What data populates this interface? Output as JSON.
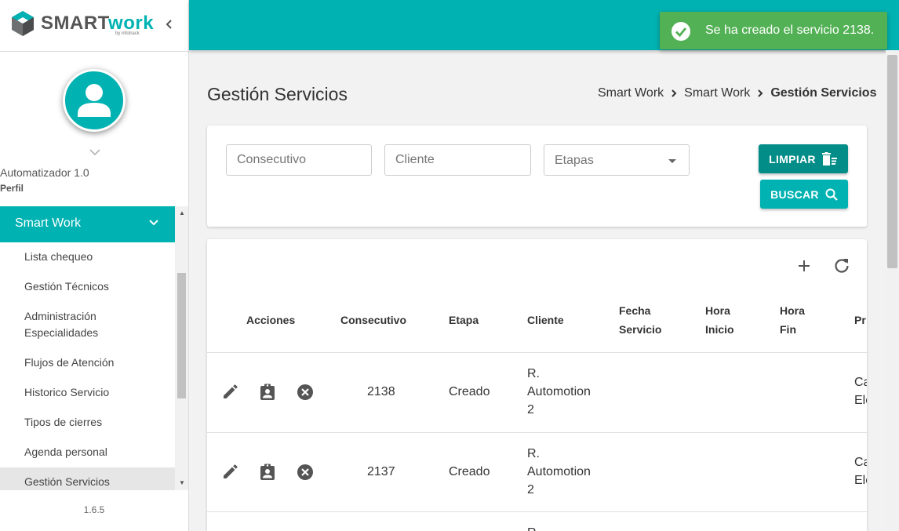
{
  "app": {
    "logo_a": "SMART",
    "logo_b": "WORK",
    "logo_sub": "by infotrack"
  },
  "profile": {
    "name": "Automatizador 1.0",
    "role": "Perfil"
  },
  "sidebar": {
    "section": "Smart Work",
    "items": [
      {
        "label": "Lista chequeo"
      },
      {
        "label": "Gestión Técnicos"
      },
      {
        "label": "Administración Especialidades"
      },
      {
        "label": "Flujos de Atención"
      },
      {
        "label": "Historico Servicio"
      },
      {
        "label": "Tipos de cierres"
      },
      {
        "label": "Agenda personal"
      },
      {
        "label": "Gestión Servicios"
      }
    ],
    "version": "1.6.5"
  },
  "toast": {
    "text": "Se ha creado el servicio 2138."
  },
  "page": {
    "title": "Gestión Servicios",
    "breadcrumb": [
      "Smart Work",
      "Smart Work",
      "Gestión Servicios"
    ]
  },
  "filters": {
    "consecutivo_placeholder": "Consecutivo",
    "cliente_placeholder": "Cliente",
    "etapas_label": "Etapas",
    "clear_label": "LIMPIAR",
    "search_label": "BUSCAR"
  },
  "table": {
    "headers": {
      "acciones": "Acciones",
      "consecutivo": "Consecutivo",
      "etapa": "Etapa",
      "cliente": "Cliente",
      "fecha_1": "Fecha",
      "fecha_2": "Servicio",
      "hora_inicio_1": "Hora",
      "hora_inicio_2": "Inicio",
      "hora_fin_1": "Hora",
      "hora_fin_2": "Fin",
      "extra": "Pr"
    },
    "rows": [
      {
        "consecutivo": "2138",
        "etapa": "Creado",
        "cliente_1": "R.",
        "cliente_2": "Automotion",
        "cliente_3": "2",
        "extra_1": "Ca",
        "extra_2": "Ele"
      },
      {
        "consecutivo": "2137",
        "etapa": "Creado",
        "cliente_1": "R.",
        "cliente_2": "Automotion",
        "cliente_3": "2",
        "extra_1": "Ca",
        "extra_2": "Ele"
      },
      {
        "consecutivo": "",
        "etapa": "",
        "cliente_1": "R.",
        "cliente_2": "",
        "cliente_3": "",
        "extra_1": "",
        "extra_2": ""
      }
    ]
  },
  "colors": {
    "primary": "#00b2b2",
    "primary_dark": "#038d88",
    "toast": "#53b155"
  }
}
